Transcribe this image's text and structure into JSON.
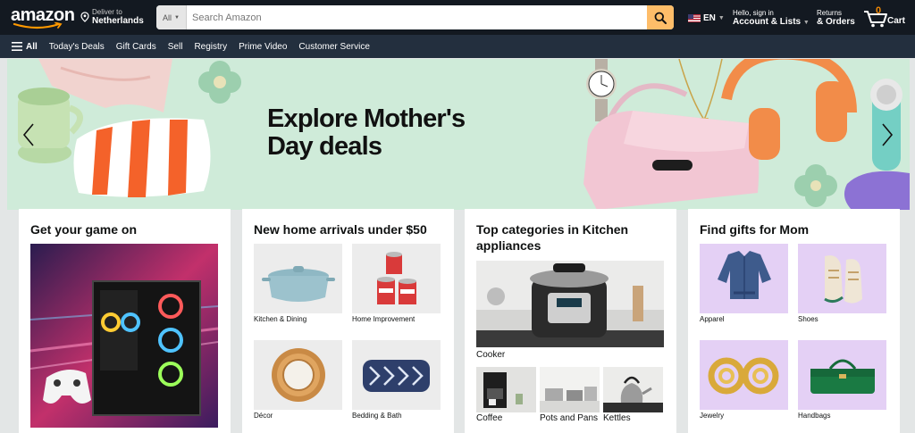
{
  "header": {
    "logo_text": "amazon",
    "deliver_line1": "Deliver to",
    "deliver_line2": "Netherlands",
    "search_category": "All",
    "search_placeholder": "Search Amazon",
    "language": "EN",
    "account_line1": "Hello, sign in",
    "account_line2": "Account & Lists",
    "returns_line1": "Returns",
    "returns_line2": "& Orders",
    "cart_count": "0",
    "cart_label": "Cart",
    "colors": {
      "nav_dark": "#131921",
      "nav_sub": "#232f3e",
      "search_button": "#febd69",
      "cart_count": "#f08804"
    }
  },
  "subnav": {
    "all_label": "All",
    "items": [
      "Today's Deals",
      "Gift Cards",
      "Sell",
      "Registry",
      "Prime Video",
      "Customer Service"
    ]
  },
  "hero": {
    "title_line1": "Explore Mother's",
    "title_line2": "Day deals",
    "background": "#cfebd9"
  },
  "cards": [
    {
      "title": "Get your game on",
      "tiles": []
    },
    {
      "title": "New home arrivals under $50",
      "tiles": [
        {
          "caption": "Kitchen & Dining"
        },
        {
          "caption": "Home Improvement"
        },
        {
          "caption": "Décor"
        },
        {
          "caption": "Bedding & Bath"
        }
      ]
    },
    {
      "title": "Top categories in Kitchen appliances",
      "tiles": [
        {
          "caption": "Cooker"
        },
        {
          "caption": "Coffee"
        },
        {
          "caption": "Pots and Pans"
        },
        {
          "caption": "Kettles"
        }
      ]
    },
    {
      "title": "Find gifts for Mom",
      "tiles": [
        {
          "caption": "Apparel"
        },
        {
          "caption": "Shoes"
        },
        {
          "caption": "Jewelry"
        },
        {
          "caption": "Handbags"
        }
      ]
    }
  ]
}
